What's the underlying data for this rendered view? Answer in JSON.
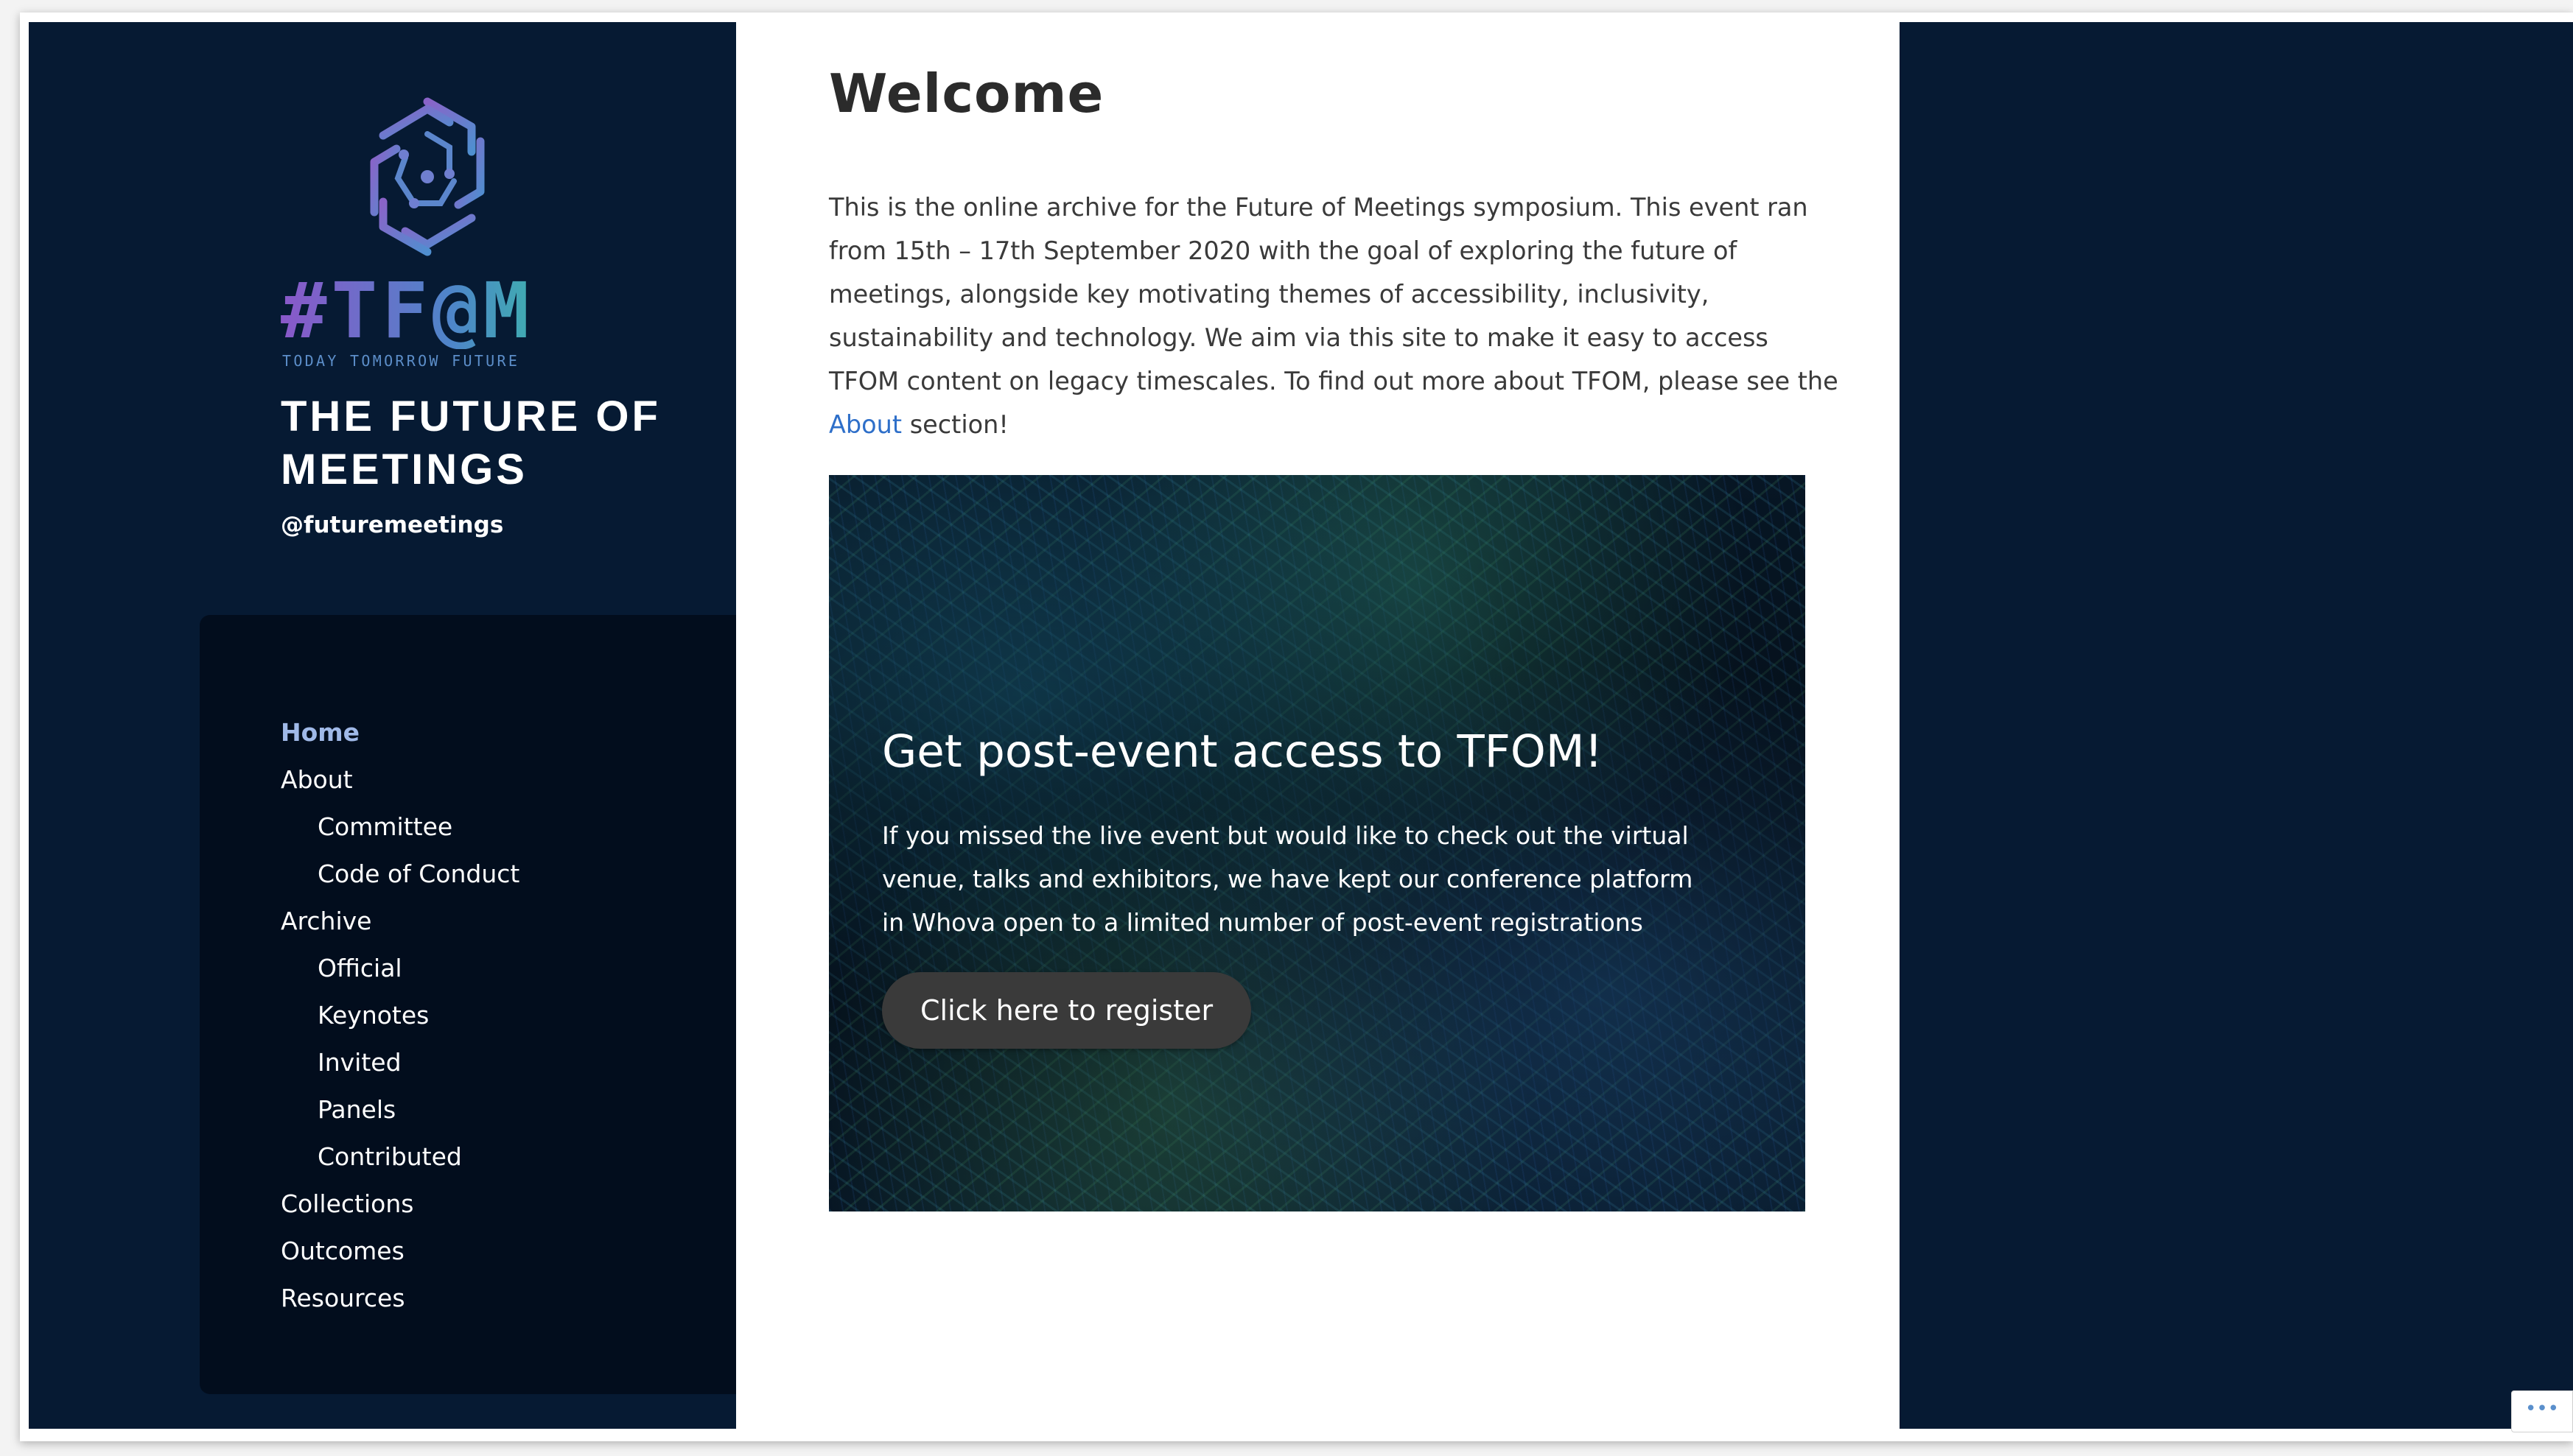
{
  "site": {
    "logo_wordmark": "#TF@M",
    "logo_tagline": "TODAY TOMORROW FUTURE",
    "title": "THE FUTURE OF MEETINGS",
    "handle": "@futuremeetings",
    "logo_colors": [
      "#8a58c9",
      "#4e85c9",
      "#35c8a0"
    ]
  },
  "nav": {
    "items": [
      {
        "label": "Home",
        "level": 0,
        "active": true
      },
      {
        "label": "About",
        "level": 0
      },
      {
        "label": "Committee",
        "level": 1
      },
      {
        "label": "Code of Conduct",
        "level": 1
      },
      {
        "label": "Archive",
        "level": 0
      },
      {
        "label": "Official",
        "level": 1
      },
      {
        "label": "Keynotes",
        "level": 1
      },
      {
        "label": "Invited",
        "level": 1
      },
      {
        "label": "Panels",
        "level": 1
      },
      {
        "label": "Contributed",
        "level": 1
      },
      {
        "label": "Collections",
        "level": 0
      },
      {
        "label": "Outcomes",
        "level": 0
      },
      {
        "label": "Resources",
        "level": 0
      }
    ]
  },
  "main": {
    "title": "Welcome",
    "intro_text": "This is the online archive for the Future of Meetings symposium. This event ran from 15th – 17th September 2020 with the goal of exploring the future of meetings, alongside key motivating themes of accessibility, inclusivity, sustainability and technology. We aim via this site to make it easy to access TFOM content on legacy timescales. To find out more about TFOM, please see the",
    "intro_link": "About",
    "intro_suffix": "section!",
    "hero": {
      "title": "Get post-event access to TFOM!",
      "text": "If you missed the live event but would like to check out the virtual venue, talks and exhibitors, we have kept our conference platform in Whova open to a limited number of post-event registrations",
      "button_label": "Click here to register"
    }
  },
  "widget": {
    "more_label": "•••"
  },
  "colors": {
    "sidebar_bg": "#061a33",
    "nav_bg": "#020d1d",
    "active_nav": "#a0b9e8",
    "link": "#2e6fc9",
    "button_bg": "#3a3a3a"
  }
}
